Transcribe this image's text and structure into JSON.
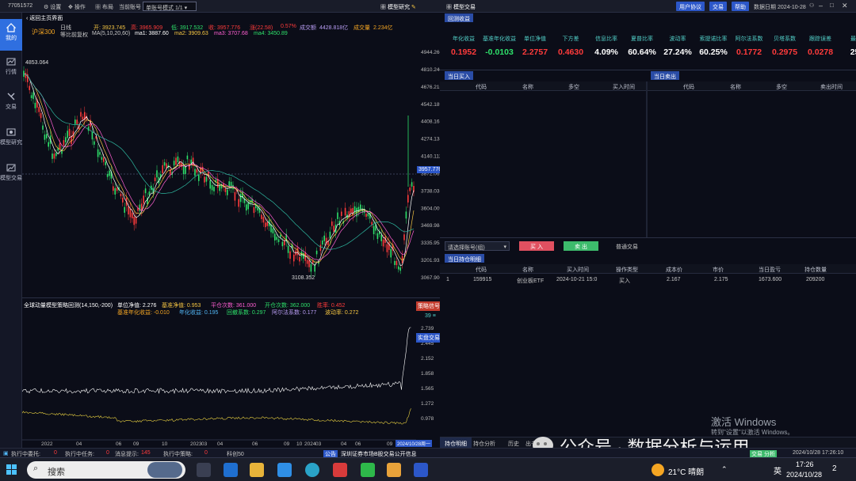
{
  "topbar": {
    "account_id": "77051572",
    "settings": "设置",
    "operation": "操作",
    "layout": "布局",
    "current_account_label": "当前账号",
    "mode_select": "单账号模式 1/1",
    "model_research": "模型研究"
  },
  "right_top": {
    "model_trade": "模型交易",
    "user_agreement": "用户协议",
    "trade": "交易",
    "help": "帮助",
    "data_date_label": "数据日期 2024-10-28"
  },
  "sidebar": {
    "items": [
      {
        "label": "我的"
      },
      {
        "label": "行情"
      },
      {
        "label": "交易"
      },
      {
        "label": "模型研究"
      },
      {
        "label": "模型交易"
      }
    ]
  },
  "chart": {
    "back": "返回主页界面",
    "index_name": "沪深300",
    "period": "日线",
    "adjust": "等比前复权",
    "ma_label": "MA(5,10,20,60)",
    "ohlc": {
      "open": "开: 3923.745",
      "high": "高: 3965.909",
      "low": "低: 3917.532",
      "close": "收: 3957.776",
      "change": "涨(22.58)",
      "pct": "0.57%",
      "amount_label": "成交额",
      "amount": "4428.818亿",
      "vol_label": "成交量",
      "vol": "2.234亿"
    },
    "ma_values": {
      "ma1": "ma1: 3887.60",
      "ma2": "ma2: 3909.63",
      "ma3": "ma3: 3707.68",
      "ma4": "ma4: 3450.89"
    },
    "price_ticks": [
      "4944.266",
      "4810.240",
      "4676.215",
      "4542.189",
      "4408.163",
      "4274.138",
      "4140.112",
      "3872.061",
      "3738.035",
      "3604.009",
      "3469.984",
      "3335.958",
      "3201.932",
      "3067.906"
    ],
    "last_price": "3957.776",
    "peak_label": "4853.064",
    "trough_label": "3108.352",
    "strategy": {
      "title": "全球动量模型策略回测(14,150,-200)",
      "nav": "单位净值: 2.276",
      "bench_nav": "基准净值: 0.953",
      "flat_times": "平仓次数: 361.000",
      "open_times": "开仓次数: 362.000",
      "win_rate": "胜率: 0.452",
      "bench_annual": "基准年化收益: -0.010",
      "annual": "年化收益: 0.195",
      "drawdown": "回撤系数: 0.297",
      "alpha": "阿尔法系数: 0.177",
      "volatility": "波动率: 0.272"
    },
    "sub_ticks": [
      "2.739",
      "2.445",
      "2.152",
      "1.858",
      "1.565",
      "1.272",
      "0.978"
    ],
    "sub_tags": {
      "strategy_tag": "策略信号",
      "days": "39 ≡",
      "live_tag": "实盘交易"
    },
    "x_ticks": [
      "2022",
      "04",
      "06",
      "09",
      "10",
      "2023",
      "03",
      "04",
      "06",
      "09",
      "10",
      "2024",
      "03",
      "04",
      "06",
      "09"
    ],
    "x_cursor": "2024/10/28周一"
  },
  "right": {
    "backtest_tab": "回测收益",
    "metrics": [
      {
        "title": "年化收益",
        "value": "0.1952",
        "color": "#ff3b3b"
      },
      {
        "title": "基准年化收益",
        "value": "-0.0103",
        "color": "#2ee06a"
      },
      {
        "title": "单位净值",
        "value": "2.2757",
        "color": "#ff3b3b"
      },
      {
        "title": "下方差",
        "value": "0.4630",
        "color": "#ff3b3b"
      },
      {
        "title": "信息比率",
        "value": "4.09%",
        "color": "#ffffff"
      },
      {
        "title": "夏普比率",
        "value": "60.64%",
        "color": "#ffffff"
      },
      {
        "title": "波动率",
        "value": "27.24%",
        "color": "#ffffff"
      },
      {
        "title": "索提诺比率",
        "value": "60.25%",
        "color": "#ffffff"
      },
      {
        "title": "阿尔法系数",
        "value": "0.1772",
        "color": "#ff3b3b"
      },
      {
        "title": "贝塔系数",
        "value": "0.2975",
        "color": "#ff3b3b"
      },
      {
        "title": "跟踪误差",
        "value": "0.0278",
        "color": "#ff3b3b"
      },
      {
        "title": "最大",
        "value": "25.",
        "color": "#ffffff"
      }
    ],
    "buy_tab": "当日买入",
    "buy_cols": [
      "代码",
      "名称",
      "多空",
      "买入时间"
    ],
    "sell_tab": "当日卖出",
    "sell_cols": [
      "代码",
      "名称",
      "多空",
      "卖出时间"
    ],
    "account_select": "请选择账号(组)",
    "buy_btn": "买 入",
    "sell_btn": "卖 出",
    "normal_trade": "普通交易",
    "position_tab": "当日持仓明细",
    "pos_cols": [
      "代码",
      "名称",
      "买入时间",
      "操作类型",
      "成本价",
      "市价",
      "当日盈亏",
      "持仓数量"
    ],
    "pos_rows": [
      [
        "1",
        "159915",
        "创业板ETF",
        "2024-10-21 15:0",
        "买入",
        "2.167",
        "2.175",
        "1673.600",
        "209200"
      ]
    ],
    "bottom_tabs": [
      "持仓明细",
      "持仓分析",
      "历史",
      "出书输出"
    ]
  },
  "bottombar": {
    "pending_label": "执行中委托:",
    "pending": "0",
    "tasks_label": "执行中任务:",
    "tasks": "0",
    "msg_label": "消息提示:",
    "msg": "145",
    "strategy_label": "执行中策略:",
    "strategy": "0",
    "sci_label": "科创50",
    "notice": "公告",
    "notice_text": "深圳证券市场B股交易公开信息",
    "right_btn": "交易 分析",
    "datetime": "2024/10/28 17:26:10"
  },
  "watermark": {
    "line1": "激活 Windows",
    "line2": "转到\"设置\"以激活 Windows。",
    "wechat": "公众号 · 数据分析与运用"
  },
  "taskbar": {
    "search": "搜索",
    "weather": "21°C 晴朗",
    "ime": "英",
    "time": "17:26",
    "date": "2024/10/28",
    "badge": "2"
  },
  "colors": {
    "up": "#ff3b3b",
    "down": "#2ee06a",
    "accent": "#2c57c9",
    "cyan": "#52d0c8"
  }
}
